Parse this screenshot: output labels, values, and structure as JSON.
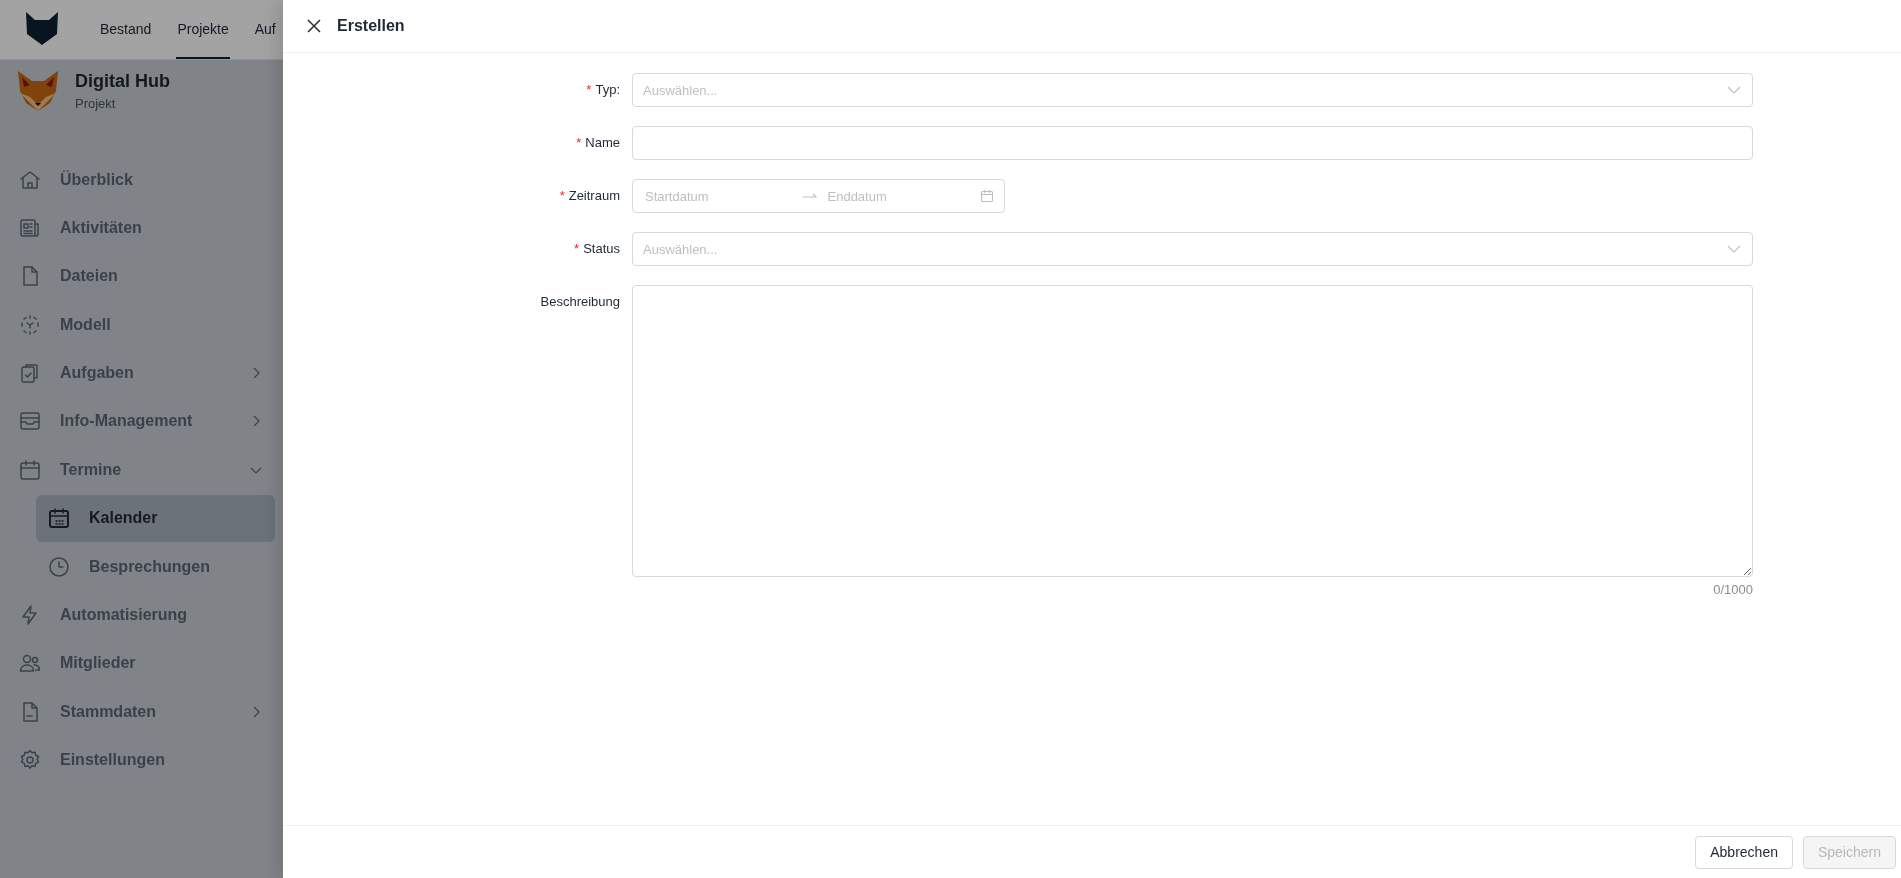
{
  "top_nav": {
    "tabs": [
      {
        "label": "Bestand",
        "selected": false
      },
      {
        "label": "Projekte",
        "selected": true
      },
      {
        "label": "Auf",
        "selected": false
      }
    ]
  },
  "project": {
    "name": "Digital Hub",
    "subtitle": "Projekt"
  },
  "sidebar": {
    "items": [
      {
        "label": "Überblick",
        "selected": false
      },
      {
        "label": "Aktivitäten",
        "selected": false
      },
      {
        "label": "Dateien",
        "selected": false
      },
      {
        "label": "Modell",
        "selected": false
      },
      {
        "label": "Aufgaben",
        "selected": false,
        "expanded": false
      },
      {
        "label": "Info-Management",
        "selected": false,
        "expanded": false
      },
      {
        "label": "Termine",
        "selected": false,
        "expanded": true,
        "children": [
          {
            "label": "Kalender",
            "selected": true
          },
          {
            "label": "Besprechungen",
            "selected": false
          }
        ]
      },
      {
        "label": "Automatisierung",
        "selected": false
      },
      {
        "label": "Mitglieder",
        "selected": false
      },
      {
        "label": "Stammdaten",
        "selected": false,
        "expanded": false
      },
      {
        "label": "Einstellungen",
        "selected": false
      }
    ]
  },
  "drawer": {
    "title": "Erstellen",
    "fields": [
      {
        "kind": "select",
        "required_mark": "*",
        "label": "Typ:",
        "placeholder": "Auswählen..."
      },
      {
        "kind": "input",
        "required_mark": "*",
        "label": "Name"
      },
      {
        "kind": "daterange",
        "required_mark": "*",
        "label": "Zeitraum",
        "start_placeholder": "Startdatum",
        "end_placeholder": "Enddatum"
      },
      {
        "kind": "select",
        "required_mark": "*",
        "label": "Status",
        "placeholder": "Auswählen..."
      },
      {
        "kind": "textarea",
        "label": "Beschreibung",
        "counter": "0/1000"
      }
    ],
    "buttons": [
      {
        "label": "Abbrechen",
        "disabled": false
      },
      {
        "label": "Speichern",
        "disabled": true
      }
    ]
  }
}
